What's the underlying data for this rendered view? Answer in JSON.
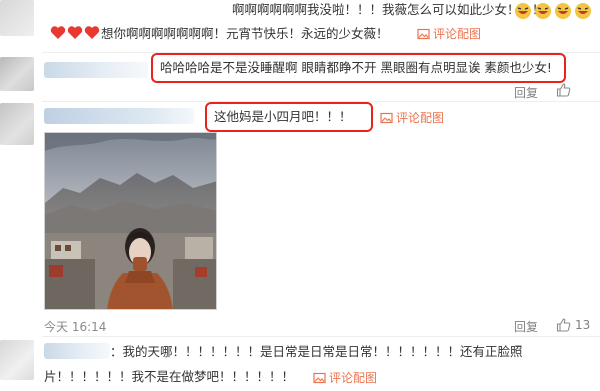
{
  "comments": [
    {
      "text_main": "啊啊啊啊啊啊我没啦！！！我薇怎么可以如此少女！！！",
      "text_line2": "想你啊啊啊啊啊啊啊！元宵节快乐！永远的少女薇！",
      "pic_link": "评论配图"
    },
    {
      "text": "哈哈哈哈是不是没睡醒啊 眼睛都睁不开 黑眼圈有点明显诶 素颜也少女!",
      "reply": "回复",
      "like": "赞"
    },
    {
      "text": "这他妈是小四月吧！！！",
      "pic_link": "评论配图",
      "time": "今天 16:14",
      "reply": "回复",
      "like_count": "13"
    },
    {
      "prefix": "：",
      "text_line1": "我的天哪！！！！！！！是日常是日常是日常！！！！！！！还有正脸照",
      "text_line2": "片！！！！！！我不是在做梦吧！！！！！！",
      "pic_link": "评论配图"
    }
  ],
  "colors": {
    "highlight_box": "#e8221f",
    "pic_link": "#eb7350",
    "meta": "#8a8a8a"
  }
}
